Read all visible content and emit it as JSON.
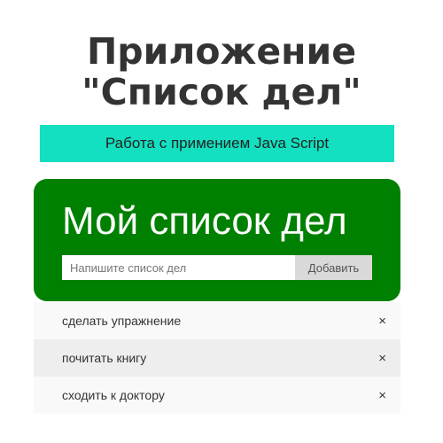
{
  "page": {
    "title": "Приложение\n\"Список дел\"",
    "subtitle": "Работа с примением Java Script"
  },
  "todo_card": {
    "heading": "Мой список дел",
    "input": {
      "value": "",
      "placeholder": "Напишите список дел"
    },
    "add_button_label": "Добавить"
  },
  "todo_items": [
    {
      "text": "сделать упражнение",
      "close_symbol": "×"
    },
    {
      "text": "почитать книгу",
      "close_symbol": "×"
    },
    {
      "text": "сходить к доктору",
      "close_symbol": "×"
    }
  ],
  "colors": {
    "subtitle_background": "#12e0c0",
    "card_background": "#008000",
    "button_background": "#d9d9d9",
    "odd_item_background": "#f9f9f9",
    "even_item_background": "#eeeeee"
  },
  "icons": {
    "delete_icon": "close-icon"
  }
}
